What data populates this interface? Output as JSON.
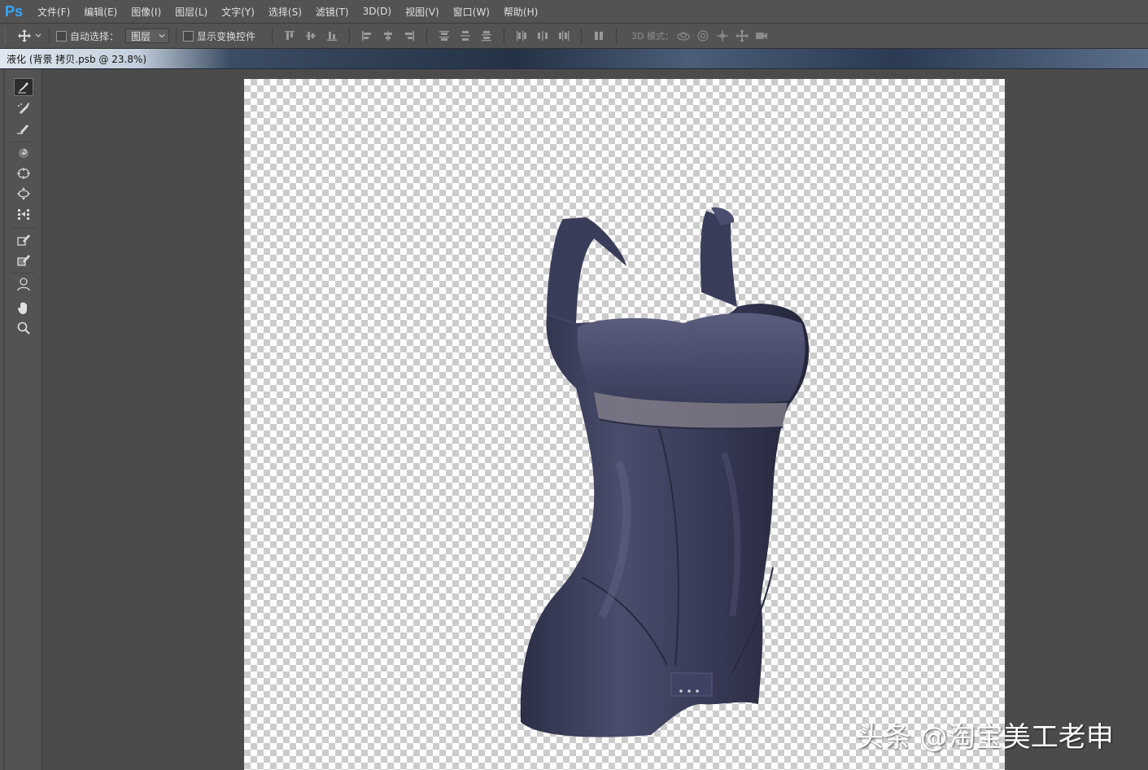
{
  "app": {
    "logo": "Ps",
    "accent_color": "#31a8ff"
  },
  "menu": [
    {
      "label": "文件(F)"
    },
    {
      "label": "编辑(E)"
    },
    {
      "label": "图像(I)"
    },
    {
      "label": "图层(L)"
    },
    {
      "label": "文字(Y)"
    },
    {
      "label": "选择(S)"
    },
    {
      "label": "滤镜(T)"
    },
    {
      "label": "3D(D)"
    },
    {
      "label": "视图(V)"
    },
    {
      "label": "窗口(W)"
    },
    {
      "label": "帮助(H)"
    }
  ],
  "options": {
    "auto_select_label": "自动选择：",
    "layer_select_value": "图层",
    "show_transform_label": "显示变换控件",
    "mode_3d_label": "3D 模式："
  },
  "document": {
    "title": "液化 (背景 拷贝.psb @ 23.8%)"
  },
  "tools": [
    {
      "icon": "forward-warp-icon",
      "active": true
    },
    {
      "icon": "reconstruct-icon"
    },
    {
      "icon": "smooth-icon"
    },
    {
      "icon": "twirl-clockwise-icon"
    },
    {
      "icon": "pucker-icon"
    },
    {
      "icon": "bloat-icon"
    },
    {
      "icon": "push-left-icon"
    },
    {
      "icon": "freeze-mask-icon"
    },
    {
      "icon": "thaw-mask-icon"
    },
    {
      "icon": "face-tool-icon"
    },
    {
      "icon": "hand-icon"
    },
    {
      "icon": "zoom-icon"
    }
  ],
  "watermark": "头条 @淘宝美工老申",
  "colors": {
    "garment": "#3a3d5a",
    "panel": "#535353",
    "workspace": "#4b4b4b"
  }
}
